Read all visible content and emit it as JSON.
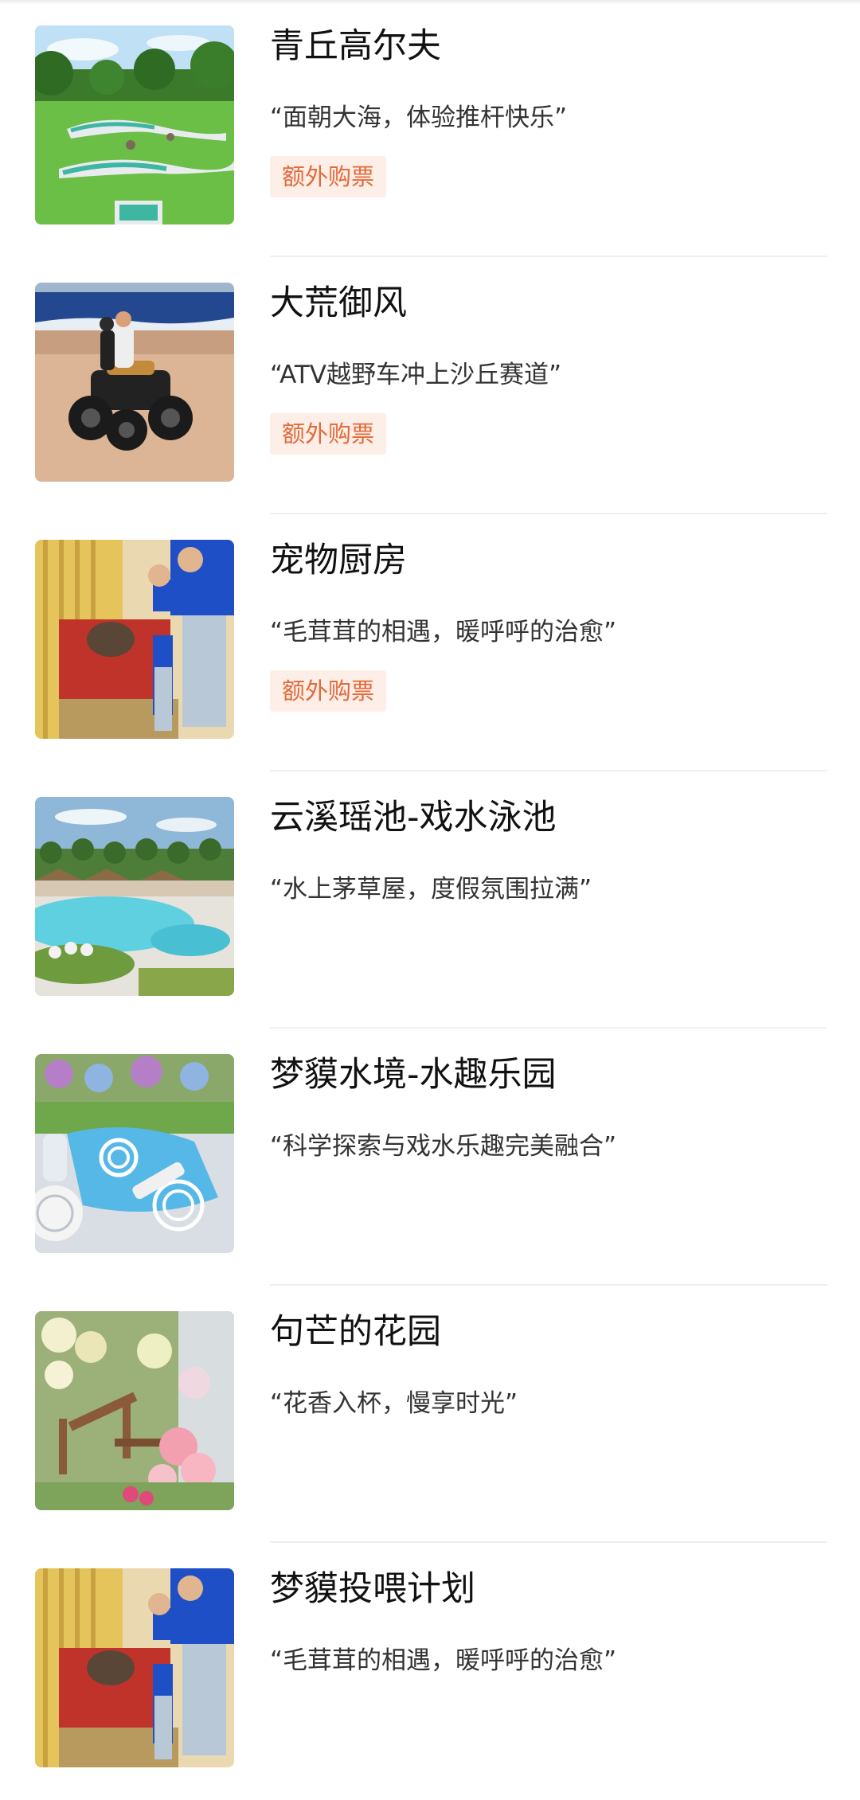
{
  "items": [
    {
      "title": "青丘高尔夫",
      "desc": "“面朝大海，体验推杆快乐”",
      "badge": "额外购票",
      "image_icon": "golf-course-photo"
    },
    {
      "title": "大荒御风",
      "desc": "“ATV越野车冲上沙丘赛道”",
      "badge": "额外购票",
      "image_icon": "atv-beach-photo"
    },
    {
      "title": "宠物厨房",
      "desc": "“毛茸茸的相遇，暖呼呼的治愈”",
      "badge": "额外购票",
      "image_icon": "pet-feeding-photo"
    },
    {
      "title": "云溪瑶池-戏水泳池",
      "desc": "“水上茅草屋，度假氛围拉满”",
      "image_icon": "pool-photo"
    },
    {
      "title": "梦貘水境-水趣乐园",
      "desc": "“科学探索与戏水乐趣完美融合”",
      "image_icon": "water-park-photo"
    },
    {
      "title": "句芒的花园",
      "desc": "“花香入杯，慢享时光”",
      "image_icon": "flower-garden-photo"
    },
    {
      "title": "梦貘投喂计划",
      "desc": "“毛茸茸的相遇，暖呼呼的治愈”",
      "image_icon": "pet-feeding-photo"
    }
  ],
  "colors": {
    "badge_bg": "#fdeee7",
    "badge_text": "#e26a3b",
    "divider": "#efefef"
  }
}
